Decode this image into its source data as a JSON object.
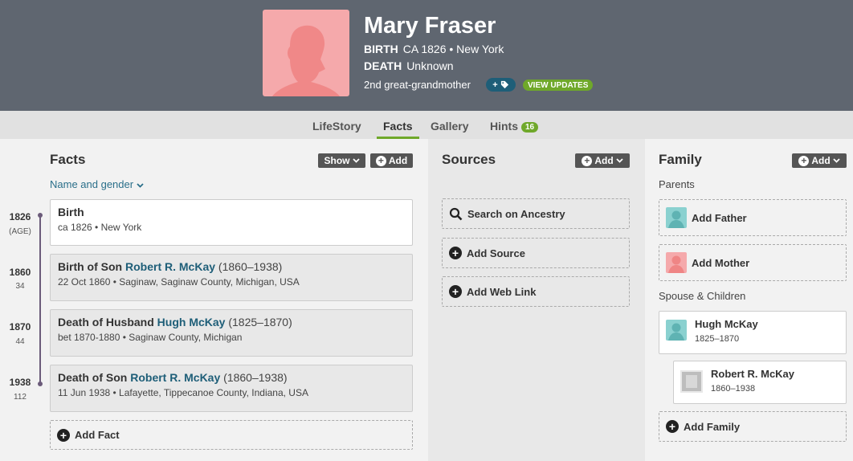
{
  "header": {
    "name": "Mary Fraser",
    "birth_label": "BIRTH",
    "birth_value": "CA 1826 • New York",
    "death_label": "DEATH",
    "death_value": "Unknown",
    "relationship": "2nd great-grandmother",
    "tag_button_plus": "+",
    "tag_icon": "tag-icon",
    "view_updates": "VIEW UPDATES",
    "portrait_color": "#f5a9ab"
  },
  "tabs": [
    {
      "label": "LifeStory",
      "active": false
    },
    {
      "label": "Facts",
      "active": true
    },
    {
      "label": "Gallery",
      "active": false
    },
    {
      "label": "Hints",
      "active": false,
      "badge": "16"
    }
  ],
  "facts": {
    "title": "Facts",
    "show_button": "Show",
    "add_button": "Add",
    "filter_label": "Name and gender",
    "timeline": [
      {
        "year": "1826",
        "sub": "(AGE)"
      },
      {
        "year": "1860",
        "sub": "34"
      },
      {
        "year": "1870",
        "sub": "44"
      },
      {
        "year": "1938",
        "sub": "112"
      }
    ],
    "items": [
      {
        "title": "Birth",
        "link": "",
        "dates": "",
        "detail": "ca 1826 • New York"
      },
      {
        "title": "Birth of Son",
        "link": "Robert R. McKay",
        "dates": "(1860–1938)",
        "detail": "22 Oct 1860 • Saginaw, Saginaw County, Michigan, USA"
      },
      {
        "title": "Death of Husband",
        "link": "Hugh McKay",
        "dates": "(1825–1870)",
        "detail": "bet 1870-1880 • Saginaw County, Michigan"
      },
      {
        "title": "Death of Son",
        "link": "Robert R. McKay",
        "dates": "(1860–1938)",
        "detail": "11 Jun 1938 • Lafayette, Tippecanoe County, Indiana, USA"
      }
    ],
    "add_fact": "Add Fact"
  },
  "sources": {
    "title": "Sources",
    "add_button": "Add",
    "search": "Search on Ancestry",
    "add_source": "Add Source",
    "add_web_link": "Add Web Link"
  },
  "family": {
    "title": "Family",
    "add_button": "Add",
    "parents_label": "Parents",
    "add_father": "Add Father",
    "add_mother": "Add Mother",
    "spouse_label": "Spouse & Children",
    "spouse": {
      "name": "Hugh McKay",
      "dates": "1825–1870"
    },
    "child": {
      "name": "Robert R. McKay",
      "dates": "1860–1938"
    },
    "add_family": "Add Family"
  },
  "colors": {
    "header_bg": "#5f6670",
    "accent_green": "#6fa82a",
    "link_blue": "#1e5e78",
    "male_avatar": "#8ad1d0",
    "female_avatar": "#f5a9ab"
  }
}
